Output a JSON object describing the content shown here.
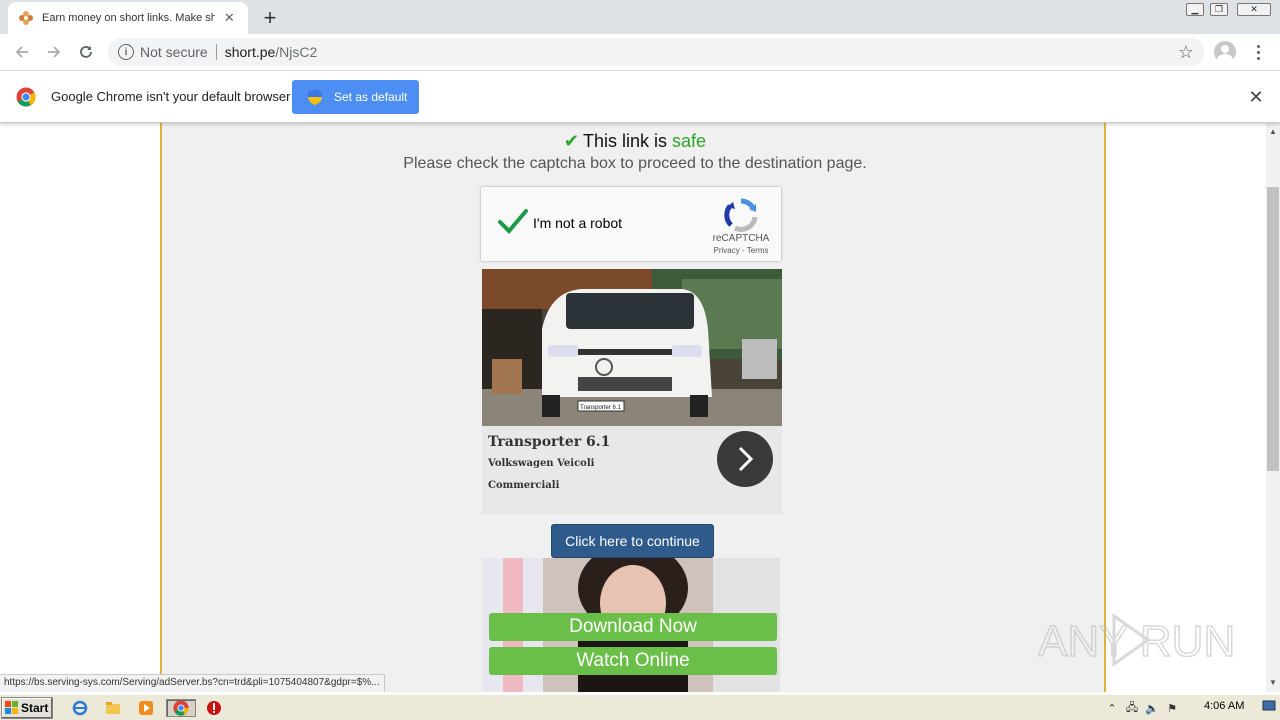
{
  "browser": {
    "tab_title": "Earn money on short links. Make sho",
    "tab_close": "✕",
    "new_tab": "+",
    "omnibox": {
      "security_label": "Not secure",
      "host": "short.pe",
      "path": "/NjsC2"
    }
  },
  "infobar": {
    "message": "Google Chrome isn't your default browser",
    "button_label": "Set as default",
    "close": "✕"
  },
  "page": {
    "safe_prefix": "This link is",
    "safe_word": "safe",
    "instruction": "Please check the captcha box to proceed to the destination page.",
    "captcha": {
      "label": "I'm not a robot",
      "brand": "reCAPTCHA",
      "links": "Privacy - Terms"
    },
    "ad1": {
      "title": "Transporter 6.1",
      "subtitle_line1": "Volkswagen Veicoli",
      "subtitle_line2": "Commerciali",
      "plate_text": "Transporter 6.1"
    },
    "continue_button": "Click here to continue",
    "ad2": {
      "download_label": "Download Now",
      "watch_label": "Watch Online"
    }
  },
  "status_url": "https://bs.serving-sys.com/Serving/adServer.bs?cn=trd&pli=1075404807&gdpr=$%...",
  "watermark": "ANY RUN",
  "taskbar": {
    "start_label": "Start",
    "clock": "4:06 AM"
  },
  "colors": {
    "safe_green": "#2aa52a",
    "border_gold": "#e3b23c",
    "continue_blue": "#2e5b8c",
    "ad_button_green": "#6abf48",
    "infobar_button_blue": "#4c8ef3"
  },
  "icons": [
    "favicon-flower-icon",
    "back-arrow-icon",
    "forward-arrow-icon",
    "reload-icon",
    "info-icon",
    "star-icon",
    "profile-icon",
    "menu-kebab-icon",
    "chrome-logo-icon",
    "shield-icon",
    "checkmark-icon",
    "recaptcha-logo-icon",
    "chevron-right-icon",
    "windows-flag-icon",
    "ie-icon",
    "explorer-icon",
    "media-player-icon",
    "chrome-icon",
    "stop-icon"
  ]
}
